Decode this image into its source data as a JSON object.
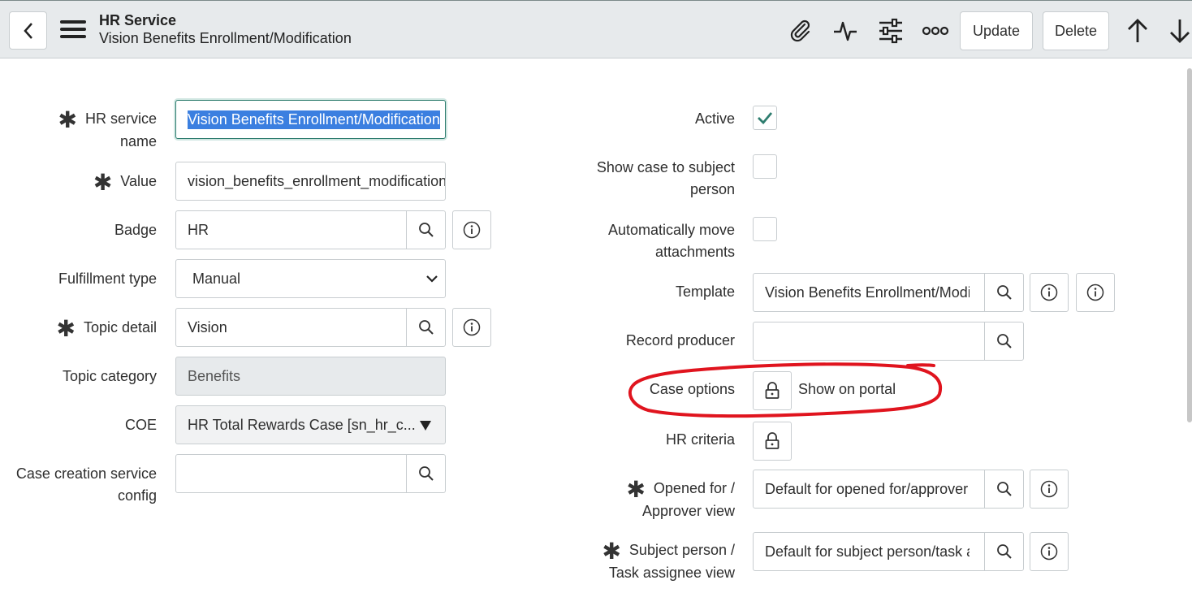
{
  "header": {
    "title": "HR Service",
    "subtitle": "Vision Benefits Enrollment/Modification",
    "update_label": "Update",
    "delete_label": "Delete"
  },
  "form": {
    "hr_service_name": {
      "label_line1": "HR service",
      "label_line2": "name",
      "value": "Vision Benefits Enrollment/Modification"
    },
    "value": {
      "label": "Value",
      "value": "vision_benefits_enrollment_modification"
    },
    "badge": {
      "label": "Badge",
      "value": "HR"
    },
    "fulfillment_type": {
      "label": "Fulfillment type",
      "value": "Manual"
    },
    "topic_detail": {
      "label": "Topic detail",
      "value": "Vision"
    },
    "topic_category": {
      "label": "Topic category",
      "value": "Benefits"
    },
    "coe": {
      "label": "COE",
      "value": "HR Total Rewards Case [sn_hr_c..."
    },
    "case_creation": {
      "label_line1": "Case creation service",
      "label_line2": "config",
      "value": ""
    },
    "active": {
      "label": "Active",
      "checked": true
    },
    "show_case": {
      "label_line1": "Show case to subject",
      "label_line2": "person",
      "checked": false
    },
    "auto_move": {
      "label_line1": "Automatically move",
      "label_line2": "attachments",
      "checked": false
    },
    "template": {
      "label": "Template",
      "value": "Vision Benefits Enrollment/Modification"
    },
    "record_producer": {
      "label": "Record producer",
      "value": ""
    },
    "case_options": {
      "label": "Case options",
      "value": "Show on portal"
    },
    "hr_criteria": {
      "label": "HR criteria"
    },
    "opened_for": {
      "label_line1": "Opened for /",
      "label_line2": "Approver view",
      "value": "Default for opened for/approver view"
    },
    "subject_person": {
      "label_line1": "Subject person /",
      "label_line2": "Task assignee view",
      "value": "Default for subject person/task assignee view"
    }
  },
  "colors": {
    "accent": "#2e7d6f",
    "annotation": "#e0141e",
    "selection": "#3b7fe0"
  }
}
